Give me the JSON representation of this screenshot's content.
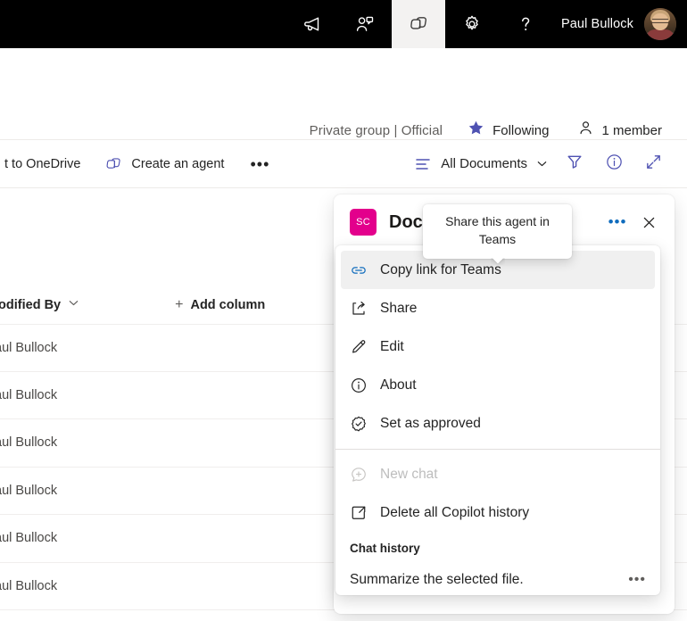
{
  "suitebar": {
    "buttons": [
      {
        "name": "megaphone-icon",
        "label": "Announcements"
      },
      {
        "name": "people-chat-icon",
        "label": "Collaborate"
      },
      {
        "name": "copilot-icon",
        "label": "Copilot",
        "active": true
      },
      {
        "name": "gear-icon",
        "label": "Settings"
      },
      {
        "name": "help-icon",
        "label": "Help"
      }
    ],
    "user_name": "Paul Bullock"
  },
  "site_header": {
    "privacy": "Private group | Official",
    "following_label": "Following",
    "members_label": "1 member"
  },
  "commandbar": {
    "onedrive_label": "t to OneDrive",
    "create_agent_label": "Create an agent",
    "more_label": "•••",
    "view_label": "All Documents",
    "filter_label": "Filter",
    "info_label": "Information",
    "expand_label": "Expand"
  },
  "list": {
    "column_modified_by": "lodified By",
    "add_column_label": "Add column",
    "rows": [
      {
        "modified_by": "aul Bullock"
      },
      {
        "modified_by": "aul Bullock"
      },
      {
        "modified_by": "aul Bullock"
      },
      {
        "modified_by": "aul Bullock"
      },
      {
        "modified_by": "aul Bullock"
      },
      {
        "modified_by": "aul Bullock"
      }
    ]
  },
  "copilot_panel": {
    "badge_text": "SC",
    "title": "Doc",
    "more_label": "•••",
    "close_label": "✕"
  },
  "tooltip": {
    "text": "Share this agent in Teams"
  },
  "context_menu": {
    "items": [
      {
        "label": "Copy link for Teams",
        "icon": "link-icon",
        "selected": true
      },
      {
        "label": "Share",
        "icon": "share-icon",
        "selected": false
      },
      {
        "label": "Edit",
        "icon": "pencil-icon",
        "selected": false
      },
      {
        "label": "About",
        "icon": "info-circle-icon",
        "selected": false
      },
      {
        "label": "Set as approved",
        "icon": "approved-badge-icon",
        "selected": false
      }
    ],
    "items2": [
      {
        "label": "New chat",
        "icon": "new-chat-icon",
        "disabled": true
      },
      {
        "label": "Delete all Copilot history",
        "icon": "open-external-icon",
        "disabled": false
      }
    ],
    "group_title": "Chat history",
    "history": [
      {
        "label": "Summarize the selected file.",
        "trailing": "•••"
      }
    ]
  },
  "colors": {
    "accent_blue": "#4f52b2",
    "link_blue": "#0f6cbd",
    "badge_magenta": "#e3008c",
    "suitebar_black": "#000000"
  }
}
